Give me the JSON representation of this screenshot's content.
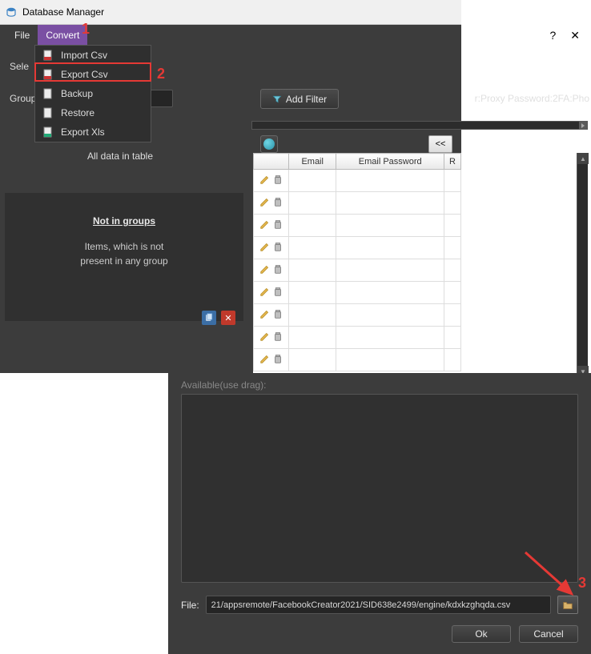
{
  "window": {
    "title": "Database Manager"
  },
  "menu": {
    "file": "File",
    "convert": "Convert",
    "items": {
      "import_csv": "Import Csv",
      "export_csv": "Export Csv",
      "backup": "Backup",
      "restore": "Restore",
      "export_xls": "Export Xls"
    }
  },
  "callouts": {
    "one": "1",
    "two": "2",
    "three": "3"
  },
  "dialog_controls": {
    "help": "?",
    "close": "✕"
  },
  "left": {
    "sele": "Sele",
    "group": "Group",
    "all_data": "All data in table",
    "not_in_groups": "Not in groups",
    "not_desc_1": "Items, which is not",
    "not_desc_2": "present in any group"
  },
  "right": {
    "add_filter": "Add Filter",
    "status_text": "r:Proxy Password:2FA:Pho",
    "pager_prev": "<<",
    "columns": {
      "c0": "",
      "c1": "Email",
      "c2": "Email Password",
      "c3": "R"
    },
    "rows": 9
  },
  "bottom": {
    "available": "Available(use drag):",
    "file_label": "File:",
    "file_value": "21/appsremote/FacebookCreator2021/SID638e2499/engine/kdxkzghqda.csv",
    "ok": "Ok",
    "cancel": "Cancel"
  }
}
